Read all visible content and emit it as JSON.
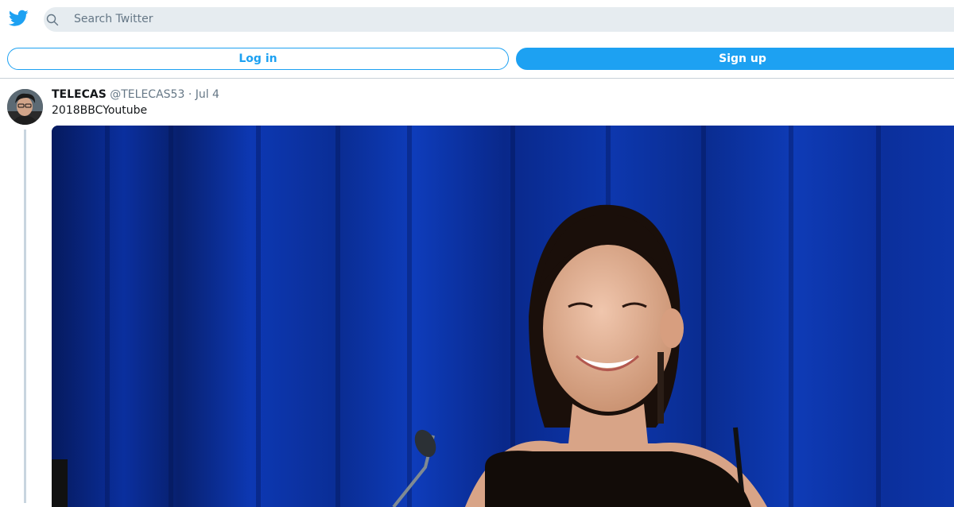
{
  "header": {
    "logo_icon": "twitter-bird-icon",
    "search": {
      "icon": "search-icon",
      "placeholder": "Search Twitter"
    }
  },
  "auth": {
    "login_label": "Log in",
    "signup_label": "Sign up"
  },
  "tweet": {
    "display_name": "TELECAS",
    "handle": "@TELECAS53",
    "separator": "·",
    "time": "Jul 4",
    "text": "2018BBCYoutube",
    "avatar_icon": "avatar"
  },
  "colors": {
    "brand": "#1da1f2",
    "search_bg": "#e6ecf0",
    "muted_text": "#657786",
    "thread_line": "#c8d5df",
    "curtain": "#0a2a8f"
  }
}
